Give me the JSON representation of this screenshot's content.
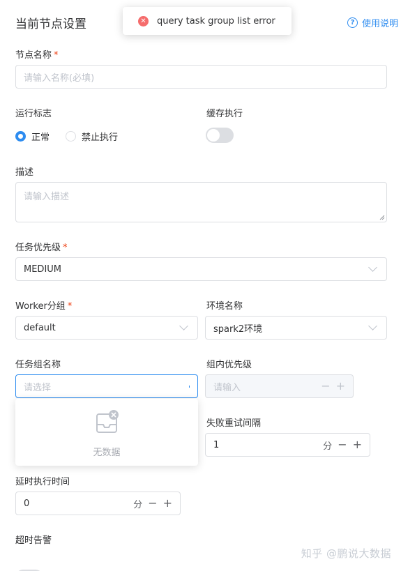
{
  "header": {
    "title": "当前节点设置",
    "help_label": "使用说明",
    "help_icon": "help-circle-icon"
  },
  "toast": {
    "message": "query task group list error",
    "icon": "error-circle-icon",
    "color": "#f56c6c"
  },
  "form": {
    "node_name": {
      "label": "节点名称",
      "required": "*",
      "placeholder": "请输入名称(必填)"
    },
    "run_flag": {
      "label": "运行标志",
      "options": [
        "正常",
        "禁止执行"
      ],
      "selected": "正常"
    },
    "cache_exec": {
      "label": "缓存执行",
      "enabled": false
    },
    "description": {
      "label": "描述",
      "placeholder": "请输入描述"
    },
    "task_priority": {
      "label": "任务优先级",
      "required": "*",
      "value": "MEDIUM"
    },
    "worker_group": {
      "label": "Worker分组",
      "required": "*",
      "value": "default"
    },
    "env_name": {
      "label": "环境名称",
      "value": "spark2环境"
    },
    "task_group": {
      "label": "任务组名称",
      "placeholder": "请选择",
      "empty_text": "无数据"
    },
    "group_priority": {
      "label": "组内优先级",
      "placeholder": "请输入"
    },
    "retry_interval": {
      "label": "失败重试间隔",
      "value": "1",
      "unit": "分"
    },
    "delay_time": {
      "label": "延时执行时间",
      "value": "0",
      "unit": "分"
    },
    "timeout_alert": {
      "label": "超时告警",
      "enabled": false
    }
  },
  "controls": {
    "minus": "−",
    "plus": "+"
  },
  "watermark": "知乎 @鹏说大数据",
  "colors": {
    "primary": "#2d8cf0",
    "required": "#ed4014",
    "border": "#dcdee2"
  }
}
